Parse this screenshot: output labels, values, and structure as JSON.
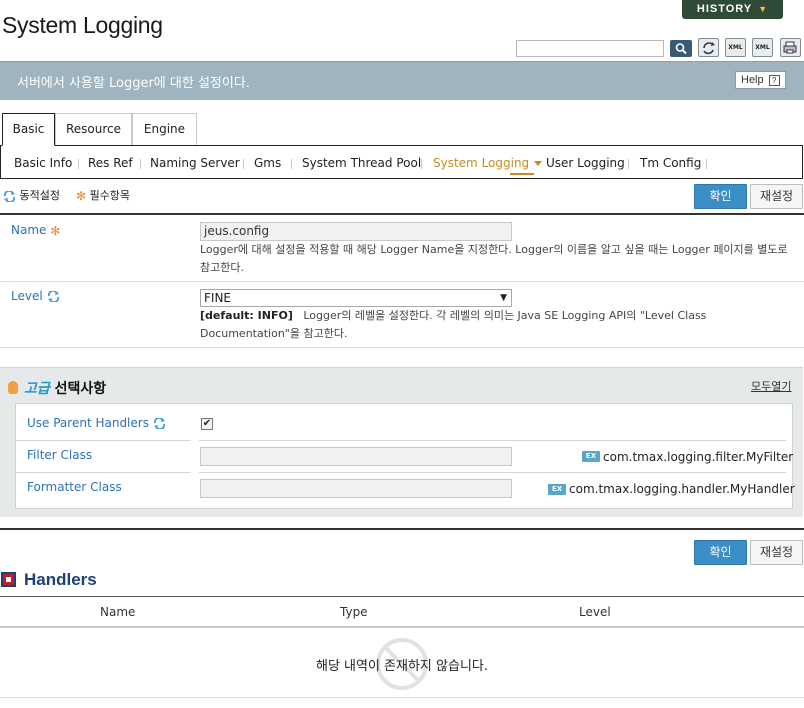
{
  "header": {
    "title": "System Logging",
    "history_label": "HISTORY",
    "toolbar_icons": [
      "search-icon",
      "refresh-icon",
      "xml-export-icon",
      "xml-import-icon",
      "print-icon"
    ]
  },
  "banner": {
    "text": "서버에서 사용할 Logger에 대한 설정이다.",
    "help_label": "Help"
  },
  "tabs": [
    {
      "label": "Basic",
      "active": true
    },
    {
      "label": "Resource",
      "active": false
    },
    {
      "label": "Engine",
      "active": false
    }
  ],
  "subnav": [
    {
      "label": "Basic Info"
    },
    {
      "label": "Res Ref"
    },
    {
      "label": "Naming Server"
    },
    {
      "label": "Gms"
    },
    {
      "label": "System Thread Pool"
    },
    {
      "label": "System Logging",
      "active": true
    },
    {
      "label": "User Logging"
    },
    {
      "label": "Tm Config"
    }
  ],
  "legend": {
    "dynamic": "동적설정",
    "required": "필수항목"
  },
  "buttons": {
    "ok": "확인",
    "reset": "재설정"
  },
  "form": {
    "name": {
      "label": "Name",
      "value": "jeus.config",
      "desc": "Logger에 대해 설정을 적용할 때 해당 Logger Name을 지정한다. Logger의 이름을 알고 싶을 때는 Logger 페이지를 별도로 참고한다."
    },
    "level": {
      "label": "Level",
      "value": "FINE",
      "default": "[default: INFO]",
      "desc": "Logger의 레벨을 설정한다. 각 레벨의 의미는 Java SE Logging API의 \"Level Class Documentation\"을 참고한다."
    }
  },
  "advanced": {
    "title_accent": "고급",
    "title_rest": " 선택사항",
    "expand_all": "모두열기",
    "use_parent_handlers": {
      "label": "Use Parent Handlers",
      "checked": true,
      "check_glyph": "✔"
    },
    "filter_class": {
      "label": "Filter Class",
      "value": "",
      "example": "com.tmax.logging.filter.MyFilter"
    },
    "formatter_class": {
      "label": "Formatter Class",
      "value": "",
      "example": "com.tmax.logging.handler.MyHandler"
    },
    "example_badge": "EX"
  },
  "handlers": {
    "title": "Handlers",
    "columns": [
      "Name",
      "Type",
      "Level"
    ],
    "empty_message": "해당 내역이 존재하지 않습니다."
  },
  "colors": {
    "accent_blue": "#3b8fc6",
    "active_nav": "#c88b1e",
    "label_blue": "#2b72b6",
    "banner": "#9fb4be"
  }
}
